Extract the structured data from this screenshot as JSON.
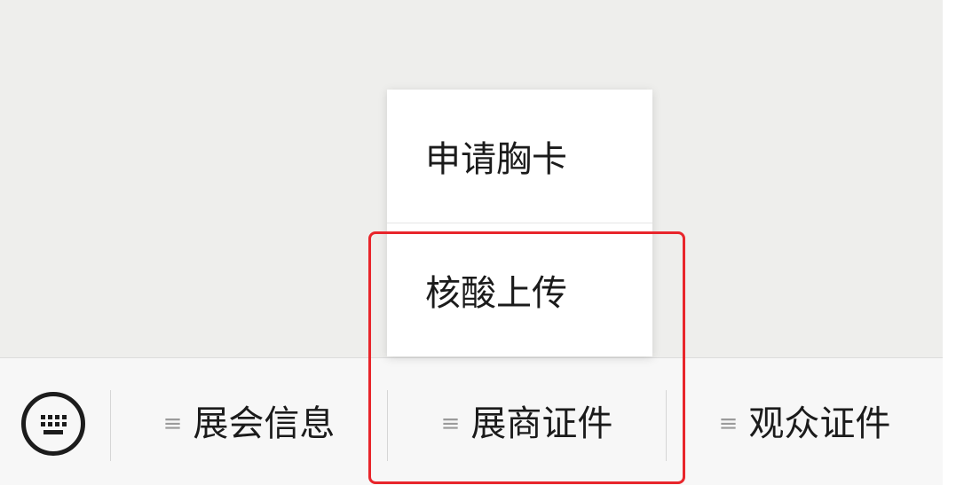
{
  "menu_bar": {
    "tabs": [
      {
        "label": "展会信息",
        "glyph": "≡"
      },
      {
        "label": "展商证件",
        "glyph": "≡"
      },
      {
        "label": "观众证件",
        "glyph": "≡"
      }
    ]
  },
  "submenu": {
    "items": [
      {
        "label": "申请胸卡"
      },
      {
        "label": "核酸上传"
      }
    ]
  },
  "colors": {
    "highlight_border": "#e8252b",
    "chat_background": "#eeeeec",
    "bar_background": "#f7f7f7"
  },
  "icons": {
    "keyboard_toggle": "keyboard-icon",
    "menu_glyph": "menu-lines-icon"
  }
}
